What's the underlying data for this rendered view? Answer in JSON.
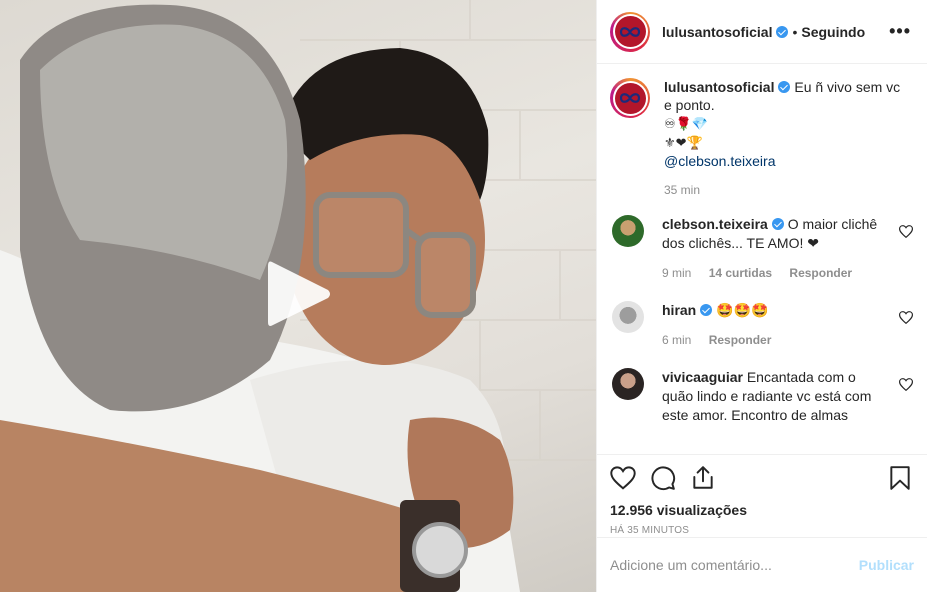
{
  "post": {
    "username": "lulusantosoficial",
    "dot": "•",
    "follow_state": "Seguindo",
    "more": "•••"
  },
  "caption": {
    "username": "lulusantosoficial",
    "text": "Eu ñ vivo sem vc e ponto.",
    "emoji_line_1": "♾🌹💎",
    "emoji_line_2": "⚜❤🏆",
    "mention": "@clebson.teixeira",
    "time": "35 min"
  },
  "comments": [
    {
      "username": "clebson.teixeira",
      "verified": true,
      "text": "O maior clichê dos clichês... TE AMO! ❤",
      "time": "9 min",
      "likes": "14 curtidas",
      "reply": "Responder"
    },
    {
      "username": "hiran",
      "verified": true,
      "text": "🤩🤩🤩",
      "time": "6 min",
      "reply": "Responder"
    },
    {
      "username": "vivicaaguiar",
      "verified": false,
      "text": "Encantada com o quão lindo e radiante vc está com este amor. Encontro de almas"
    }
  ],
  "stats": {
    "views": "12.956 visualizações",
    "time_ago": "HÁ 35 MINUTOS"
  },
  "add_comment": {
    "placeholder": "Adicione um comentário...",
    "publish": "Publicar"
  },
  "icons": {
    "like": "heart-icon",
    "comment": "comment-icon",
    "share": "share-icon",
    "save": "bookmark-icon",
    "play": "play-icon"
  },
  "colors": {
    "verified": "#3897f0",
    "mention": "#003569",
    "publish_disabled": "#b2dffc",
    "heart_red": "#ed4956"
  }
}
